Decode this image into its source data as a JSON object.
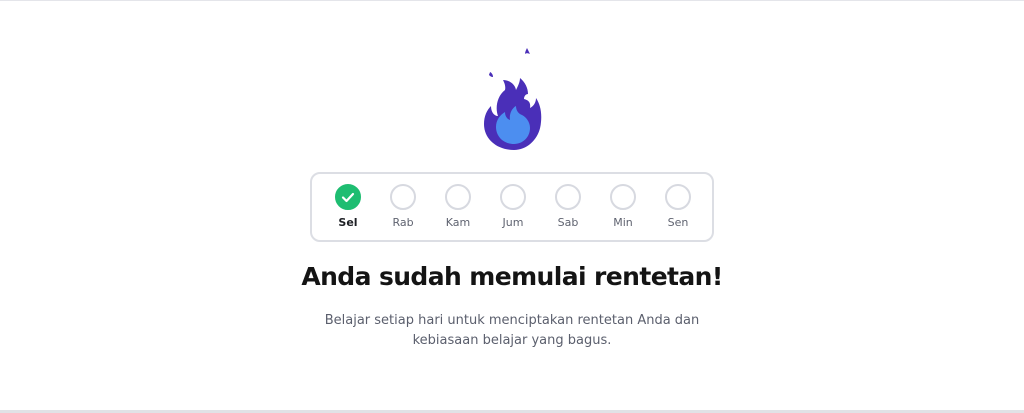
{
  "streak": {
    "days": [
      {
        "label": "Sel",
        "completed": true
      },
      {
        "label": "Rab",
        "completed": false
      },
      {
        "label": "Kam",
        "completed": false
      },
      {
        "label": "Jum",
        "completed": false
      },
      {
        "label": "Sab",
        "completed": false
      },
      {
        "label": "Min",
        "completed": false
      },
      {
        "label": "Sen",
        "completed": false
      }
    ]
  },
  "heading": "Anda sudah memulai rentetan!",
  "description": "Belajar setiap hari untuk menciptakan rentetan Anda dan kebiasaan belajar yang bagus.",
  "icons": {
    "flame": "flame-icon",
    "check": "check-icon"
  },
  "colors": {
    "flame_outer": "#4a2fb8",
    "flame_inner": "#4c8ef0",
    "completed": "#1ebd71",
    "pending_border": "#d7d9e0"
  }
}
